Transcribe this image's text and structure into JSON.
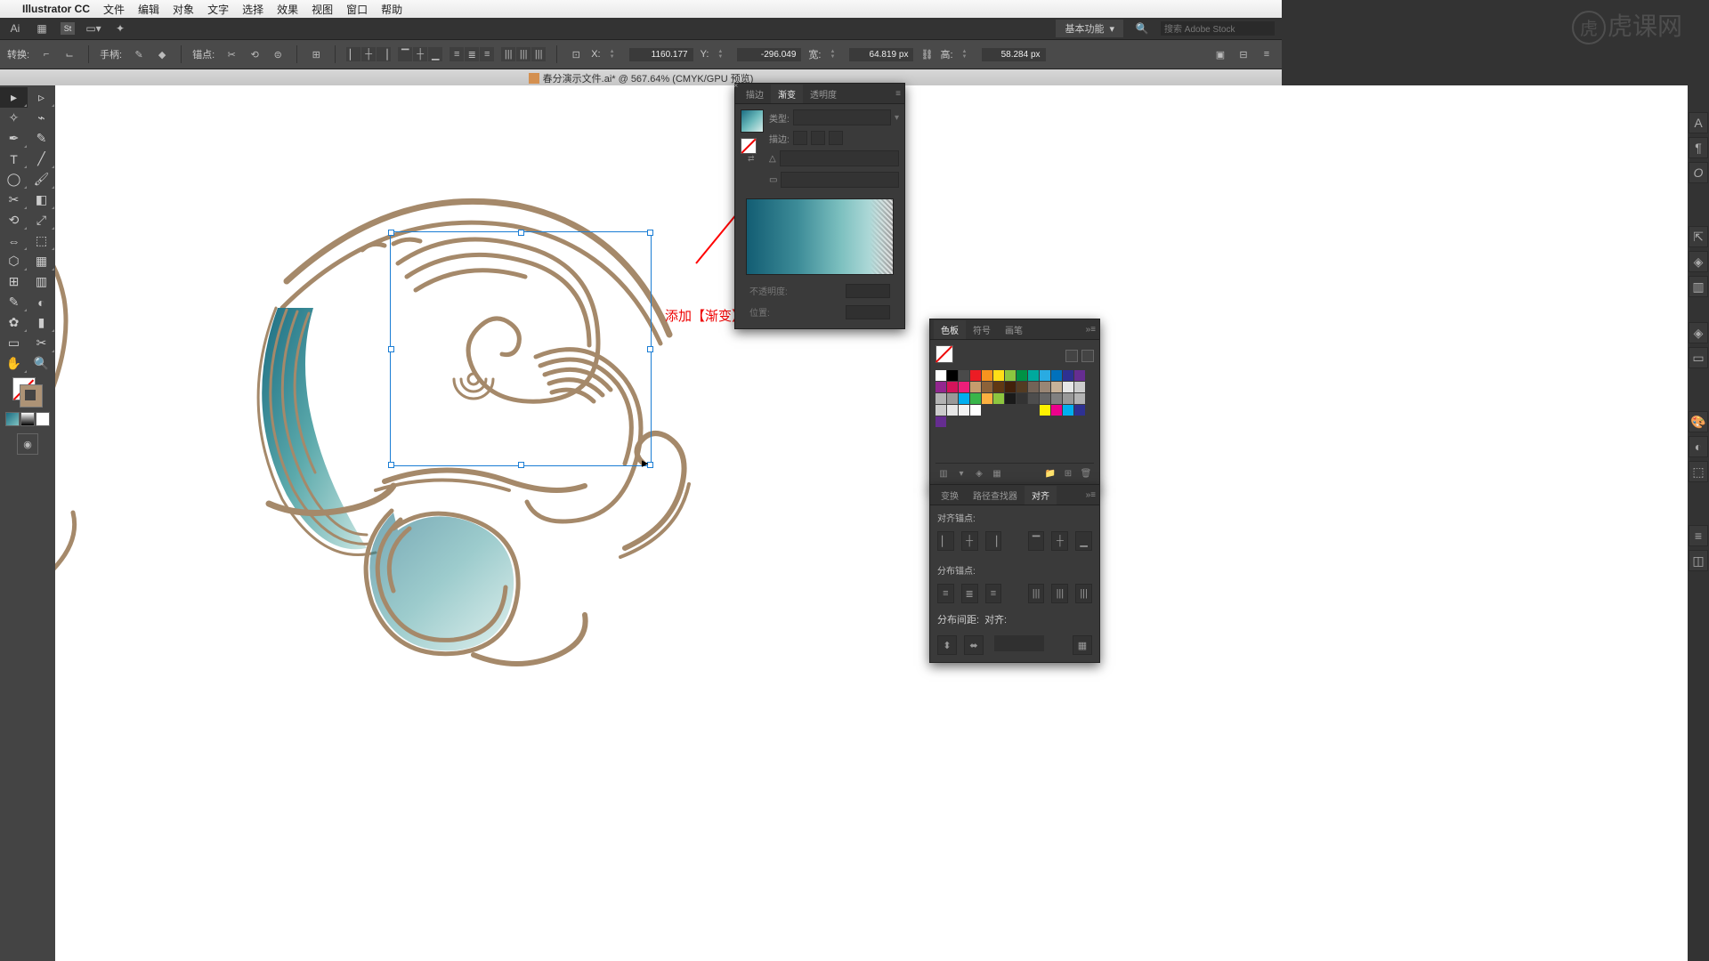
{
  "menubar": {
    "app": "Illustrator CC",
    "items": [
      "文件",
      "编辑",
      "对象",
      "文字",
      "选择",
      "效果",
      "视图",
      "窗口",
      "帮助"
    ]
  },
  "appbar": {
    "workspace": "基本功能",
    "search_ph": "搜索 Adobe Stock"
  },
  "ctrlbar": {
    "transform": "转换:",
    "handle": "手柄:",
    "anchor": "锚点:",
    "x": "X:",
    "xv": "1160.177",
    "y": "Y:",
    "yv": "-296.049",
    "w": "宽:",
    "wv": "64.819 px",
    "h": "高:",
    "hv": "58.284 px"
  },
  "doc_title": "春分演示文件.ai* @ 567.64% (CMYK/GPU 预览)",
  "gradient": {
    "tabs": [
      "描边",
      "渐变",
      "透明度"
    ],
    "type": "类型:",
    "stroke": "描边:",
    "opacity": "不透明度:",
    "location": "位置:"
  },
  "swatches": {
    "tabs": [
      "色板",
      "符号",
      "画笔"
    ]
  },
  "align": {
    "tabs": [
      "变换",
      "路径查找器",
      "对齐"
    ],
    "sect1": "对齐锚点:",
    "sect2": "分布锚点:",
    "sect3": "分布间距:",
    "sect3r": "对齐:"
  },
  "annotation": "添加【渐变】效果",
  "watermark": "虎课网",
  "swatch_colors": [
    [
      "#fff",
      "#000",
      "#4a4a4a",
      "#ec1c24",
      "#f7931e",
      "#ffde17",
      "#8cc63f",
      "#009245",
      "#00a99d",
      "#29abe2",
      "#0071bc",
      "#2e3192",
      "#662d91",
      "#93278f",
      "#d4145a",
      "#ed1e79"
    ],
    [
      "#c69c6d",
      "#8c6239",
      "#603813",
      "#42210b",
      "#533b22",
      "#736357",
      "#998675",
      "#c7b299",
      "#e6e6e6",
      "#ccc",
      "#b3b3b3",
      "#999",
      "#00aeef",
      "#39b54a",
      "#fbb040",
      "#8dc63f"
    ],
    [
      "#1a1a1a",
      "#333",
      "#4d4d4d",
      "#666",
      "#808080",
      "#999",
      "#b3b3b3",
      "#ccc",
      "#e6e6e6",
      "#f2f2f2",
      "#fff",
      "",
      "",
      "",
      "",
      ""
    ],
    [
      "#fff200",
      "#ec008c",
      "#00aeef",
      "#2e3192",
      "#652d90",
      "",
      "",
      "",
      "",
      "",
      "",
      "",
      "",
      "",
      "",
      ""
    ]
  ]
}
